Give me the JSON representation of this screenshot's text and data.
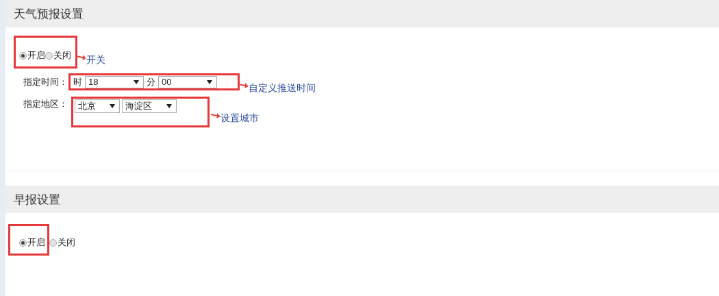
{
  "sections": [
    {
      "title": "天气预报设置",
      "switch": [
        {
          "label": "开启",
          "selected": true,
          "highlighted": true
        },
        {
          "label": "关闭",
          "selected": false,
          "highlighted": true
        }
      ],
      "switch_note": "开关",
      "fields": [
        {
          "label": "指定时间：",
          "highlighted": true,
          "note": "自定义推送时间",
          "parts": [
            {
              "kind": "text",
              "text": "时"
            },
            {
              "kind": "select",
              "value": "18"
            },
            {
              "kind": "text",
              "text": "分"
            },
            {
              "kind": "select",
              "value": "00"
            }
          ]
        },
        {
          "label": "指定地区：",
          "highlighted": true,
          "note": "设置城市",
          "parts": [
            {
              "kind": "select",
              "value": "北京"
            },
            {
              "kind": "select",
              "value": "海淀区"
            }
          ]
        }
      ]
    },
    {
      "title": "早报设置",
      "switch": [
        {
          "label": "开启",
          "selected": true,
          "highlighted": true
        },
        {
          "label": "关闭",
          "selected": false,
          "highlighted": false
        }
      ]
    }
  ]
}
